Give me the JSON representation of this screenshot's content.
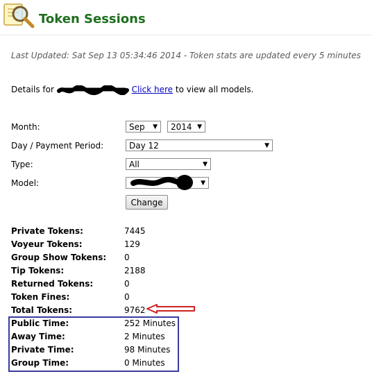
{
  "header": {
    "title": "Token Sessions"
  },
  "last_updated": "Last Updated: Sat Sep 13 05:34:46 2014 - Token stats are updated every 5 minutes",
  "details": {
    "prefix": "Details for",
    "link_text": "Click here",
    "suffix": "to view all models."
  },
  "form": {
    "month_label": "Month:",
    "month_value": "Sep",
    "year_value": "2014",
    "period_label": "Day / Payment Period:",
    "period_value": "Day 12",
    "type_label": "Type:",
    "type_value": "All",
    "model_label": "Model:",
    "model_value": "",
    "change_button": "Change"
  },
  "stats": [
    {
      "label": "Private Tokens:",
      "value": "7445"
    },
    {
      "label": "Voyeur Tokens:",
      "value": "129"
    },
    {
      "label": "Group Show Tokens:",
      "value": "0"
    },
    {
      "label": "Tip Tokens:",
      "value": "2188"
    },
    {
      "label": "Returned Tokens:",
      "value": "0"
    },
    {
      "label": "Token Fines:",
      "value": "0"
    },
    {
      "label": "Total Tokens:",
      "value": "9762"
    },
    {
      "label": "Public Time:",
      "value": "252 Minutes"
    },
    {
      "label": "Away Time:",
      "value": "2 Minutes"
    },
    {
      "label": "Private Time:",
      "value": "98 Minutes"
    },
    {
      "label": "Group Time:",
      "value": "0 Minutes"
    }
  ],
  "colors": {
    "title": "#1e6e1e",
    "link": "#0000cc",
    "annotation_arrow": "#cc2222",
    "annotation_box": "#3a3aa0"
  },
  "icons": {
    "logo": "magnifier-document-icon"
  }
}
